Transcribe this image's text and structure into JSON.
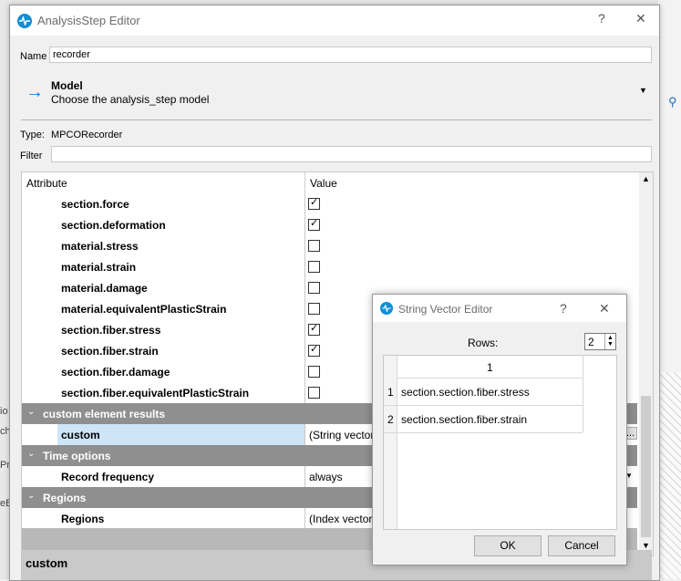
{
  "main_window": {
    "title": "AnalysisStep Editor",
    "help_button": "?",
    "close_button": "✕",
    "name_label": "Name",
    "name_value": "recorder",
    "model_title": "Model",
    "model_subtitle": "Choose the analysis_step model",
    "type_label": "Type:",
    "type_value": "MPCORecorder",
    "filter_label": "Filter",
    "filter_value": ""
  },
  "table": {
    "header_attribute": "Attribute",
    "header_value": "Value",
    "rows": [
      {
        "label": "section.force",
        "checked": true
      },
      {
        "label": "section.deformation",
        "checked": true
      },
      {
        "label": "material.stress",
        "checked": false
      },
      {
        "label": "material.strain",
        "checked": false
      },
      {
        "label": "material.damage",
        "checked": false
      },
      {
        "label": "material.equivalentPlasticStrain",
        "checked": false
      },
      {
        "label": "section.fiber.stress",
        "checked": true
      },
      {
        "label": "section.fiber.strain",
        "checked": true
      },
      {
        "label": "section.fiber.damage",
        "checked": false
      },
      {
        "label": "section.fiber.equivalentPlasticStrain",
        "checked": false
      }
    ],
    "group_custom": "custom element results",
    "custom_label": "custom",
    "custom_value": "(String vector)",
    "custom_browse": "...",
    "group_time": "Time options",
    "record_frequency_label": "Record frequency",
    "record_frequency_value": "always",
    "group_regions": "Regions",
    "regions_label": "Regions",
    "regions_value": "(Index vector)"
  },
  "description": {
    "title": "custom"
  },
  "string_vector_dialog": {
    "title": "String Vector Editor",
    "help_button": "?",
    "close_button": "✕",
    "rows_label": "Rows:",
    "rows_value": "2",
    "column_header": "1",
    "row_numbers": [
      "1",
      "2"
    ],
    "items": [
      "section.section.fiber.stress",
      "section.section.fiber.strain"
    ],
    "ok_label": "OK",
    "cancel_label": "Cancel"
  },
  "background": {
    "left_fragments": [
      "io",
      "ch",
      "Pr",
      "eB"
    ]
  },
  "colors": {
    "accent": "#0e8fd6",
    "group_header": "#8f8f8f",
    "selection": "#cde5f7"
  }
}
